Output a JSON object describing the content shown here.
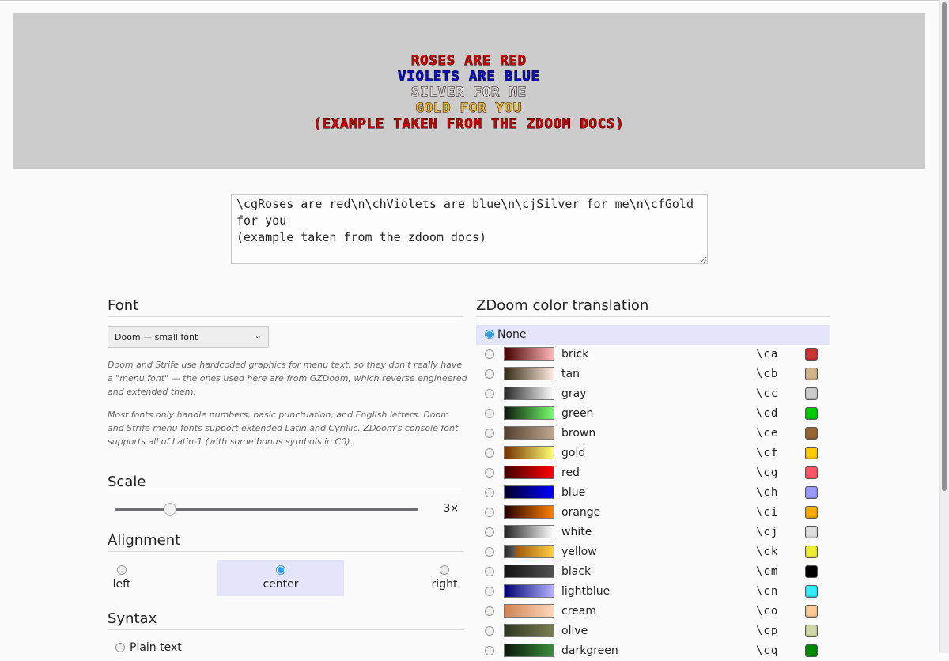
{
  "preview": {
    "lines": [
      {
        "text": "Roses are red",
        "color": "#d40000"
      },
      {
        "text": "Violets are blue",
        "color": "#0010c8"
      },
      {
        "text": "Silver for me",
        "color": "#d8d8d8"
      },
      {
        "text": "Gold for you",
        "color": "#e8b838"
      },
      {
        "text": "(example taken from the zdoom docs)",
        "color": "#d40000"
      }
    ]
  },
  "source": {
    "value": "\\cgRoses are red\\n\\chViolets are blue\\n\\cjSilver for me\\n\\cfGold for you\n(example taken from the zdoom docs)"
  },
  "font": {
    "heading": "Font",
    "selected": "Doom — small font",
    "note1": "Doom and Strife use hardcoded graphics for menu text, so they don't really have a \"menu font\" — the ones used here are from GZDoom, which reverse engineered and extended them.",
    "note2": "Most fonts only handle numbers, basic punctuation, and English letters. Doom and Strife menu fonts support extended Latin and Cyrillic. ZDoom's console font supports all of Latin-1 (with some bonus symbols in C0)."
  },
  "scale": {
    "heading": "Scale",
    "value": 3,
    "min": 1,
    "max": 12,
    "label": "3×"
  },
  "alignment": {
    "heading": "Alignment",
    "options": [
      {
        "label": "left",
        "selected": false
      },
      {
        "label": "center",
        "selected": true
      },
      {
        "label": "right",
        "selected": false
      }
    ]
  },
  "syntax": {
    "heading": "Syntax",
    "options": [
      {
        "label": "Plain text",
        "selected": false
      }
    ]
  },
  "colors": {
    "heading": "ZDoom color translation",
    "none_label": "None",
    "none_selected": true,
    "items": [
      {
        "name": "brick",
        "code": "\\ca",
        "swatch": "#cc3333",
        "grad": [
          "#470000",
          "#ffb8b8"
        ]
      },
      {
        "name": "tan",
        "code": "\\cb",
        "swatch": "#d2b48c",
        "grad": [
          "#332b13",
          "#ffebdf"
        ]
      },
      {
        "name": "gray",
        "code": "\\cc",
        "swatch": "#cccccc",
        "grad": [
          "#272727",
          "#ffffff"
        ]
      },
      {
        "name": "green",
        "code": "\\cd",
        "swatch": "#00cc00",
        "grad": [
          "#0b170b",
          "#77ff6f"
        ]
      },
      {
        "name": "brown",
        "code": "\\ce",
        "swatch": "#996633",
        "grad": [
          "#533f2f",
          "#bfa78f"
        ]
      },
      {
        "name": "gold",
        "code": "\\cf",
        "swatch": "#ffcc00",
        "grad": [
          "#733000",
          "#ffff73"
        ]
      },
      {
        "name": "red",
        "code": "\\cg",
        "swatch": "#ff5566",
        "grad": [
          "#3f0000",
          "#ff0000"
        ]
      },
      {
        "name": "blue",
        "code": "\\ch",
        "swatch": "#9999ff",
        "grad": [
          "#000027",
          "#0000ff"
        ]
      },
      {
        "name": "orange",
        "code": "\\ci",
        "swatch": "#ffaa00",
        "grad": [
          "#200000",
          "#ff8000"
        ]
      },
      {
        "name": "white",
        "code": "\\cj",
        "swatch": "#dfdfdf",
        "grad": [
          "#242424",
          "#ffffff"
        ]
      },
      {
        "name": "yellow",
        "code": "\\ck",
        "swatch": "#eeee33",
        "grad": [
          "#272727",
          "#ffd040"
        ]
      },
      {
        "name": "black",
        "code": "\\cm",
        "swatch": "#000000",
        "grad": [
          "#131313",
          "#505050"
        ]
      },
      {
        "name": "lightblue",
        "code": "\\cn",
        "swatch": "#33eeff",
        "grad": [
          "#000073",
          "#b4b4ff"
        ]
      },
      {
        "name": "cream",
        "code": "\\co",
        "swatch": "#ffcc99",
        "grad": [
          "#cf8353",
          "#ffd7bb"
        ]
      },
      {
        "name": "olive",
        "code": "\\cp",
        "swatch": "#d1d8a8",
        "grad": [
          "#2f3723",
          "#7b7f50"
        ]
      },
      {
        "name": "darkgreen",
        "code": "\\cq",
        "swatch": "#008c00",
        "grad": [
          "#0b170b",
          "#3b8f3b"
        ]
      }
    ]
  }
}
